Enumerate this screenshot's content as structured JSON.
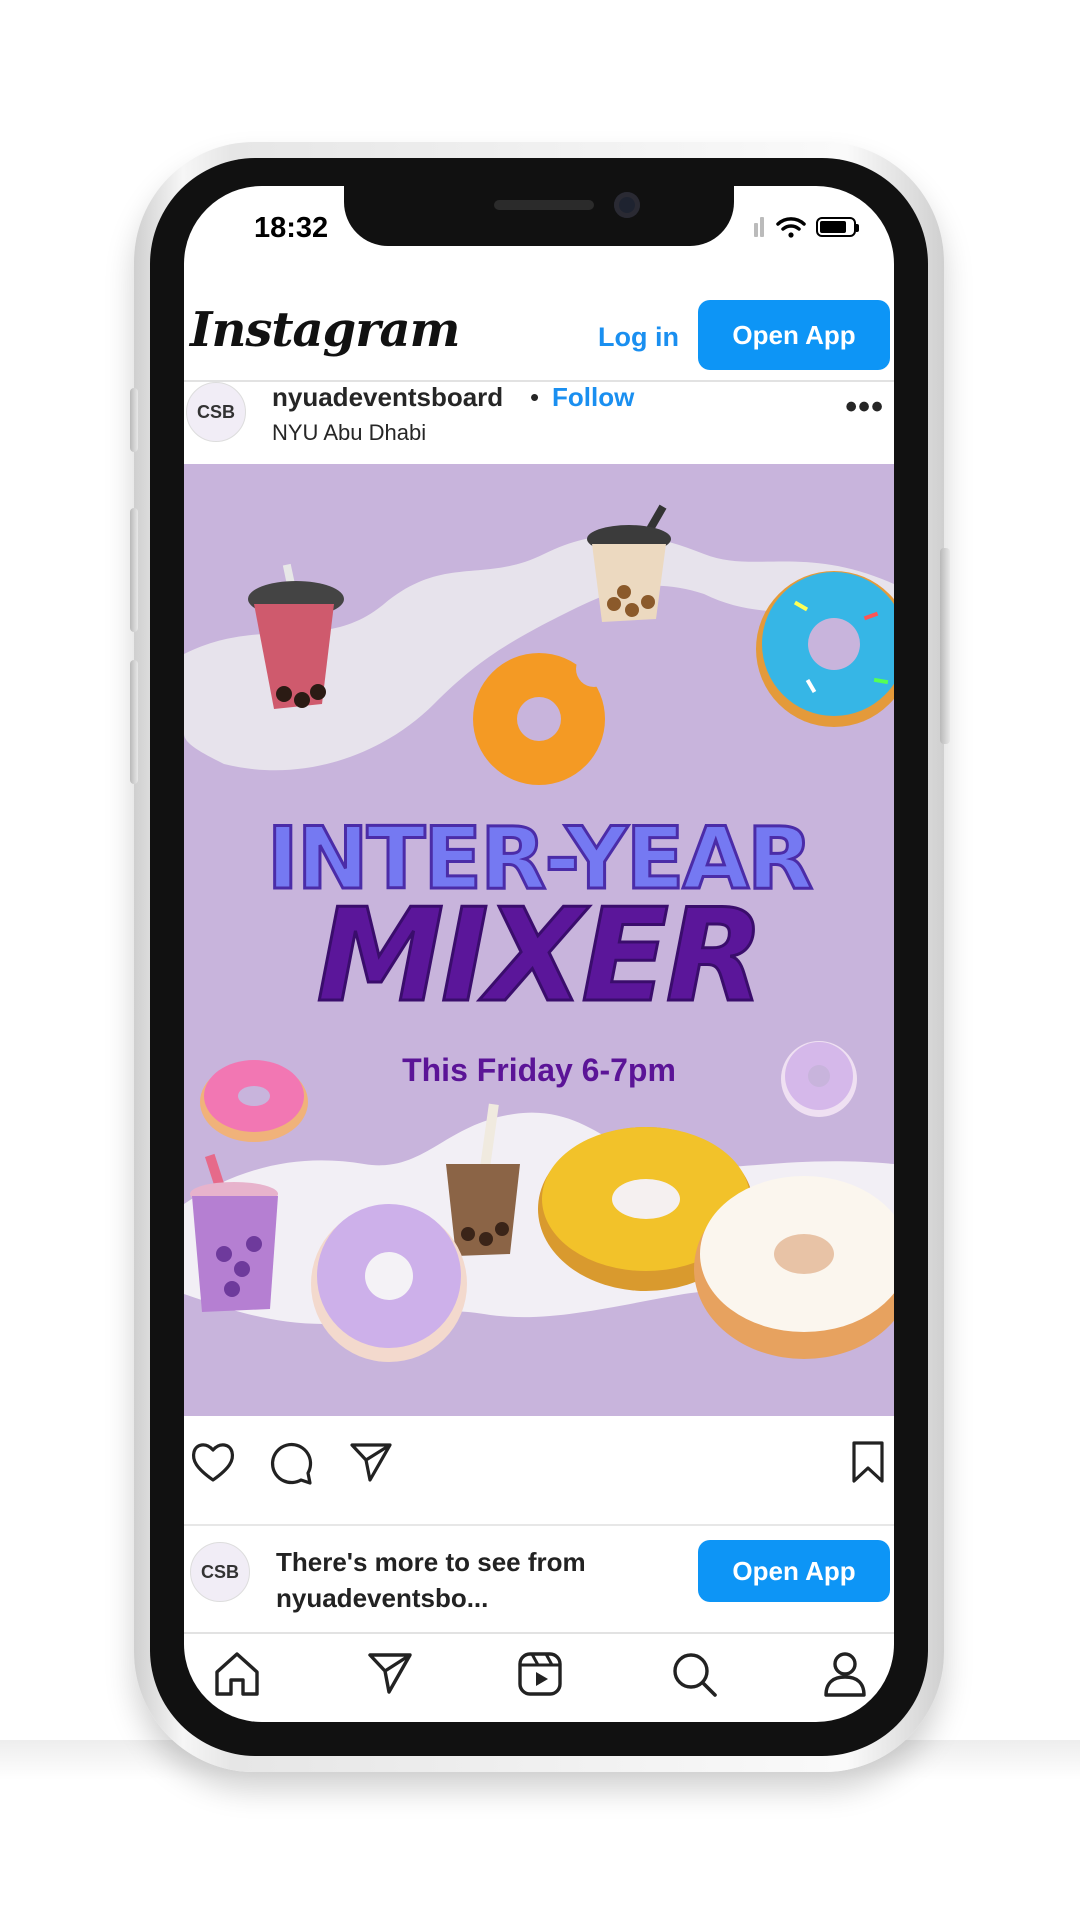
{
  "status_bar": {
    "time": "18:32"
  },
  "header": {
    "logo": "Instagram",
    "login_label": "Log in",
    "open_app_label": "Open App"
  },
  "post": {
    "avatar_text": "CSB",
    "username": "nyuadeventsboard",
    "separator": "•",
    "follow_label": "Follow",
    "location": "NYU Abu Dhabi",
    "more_icon": "more-horizontal-icon",
    "image": {
      "title_line1": "INTER-YEAR",
      "title_line2": "MIXER",
      "subtitle": "This Friday 6-7pm",
      "background": "#c8b4dc"
    },
    "actions": [
      "heart-icon",
      "comment-icon",
      "share-icon",
      "bookmark-icon"
    ]
  },
  "more_banner": {
    "text_line1": "There's more to see from",
    "text_line2": "nyuadeventsbo...",
    "button_label": "Open App"
  },
  "bottom_nav": [
    "home-icon",
    "direct-icon",
    "reels-icon",
    "search-icon",
    "profile-icon"
  ],
  "colors": {
    "accent": "#0d95f6",
    "link": "#1a8ff0",
    "title_light": "#7579f2",
    "title_dark": "#5b169a"
  }
}
